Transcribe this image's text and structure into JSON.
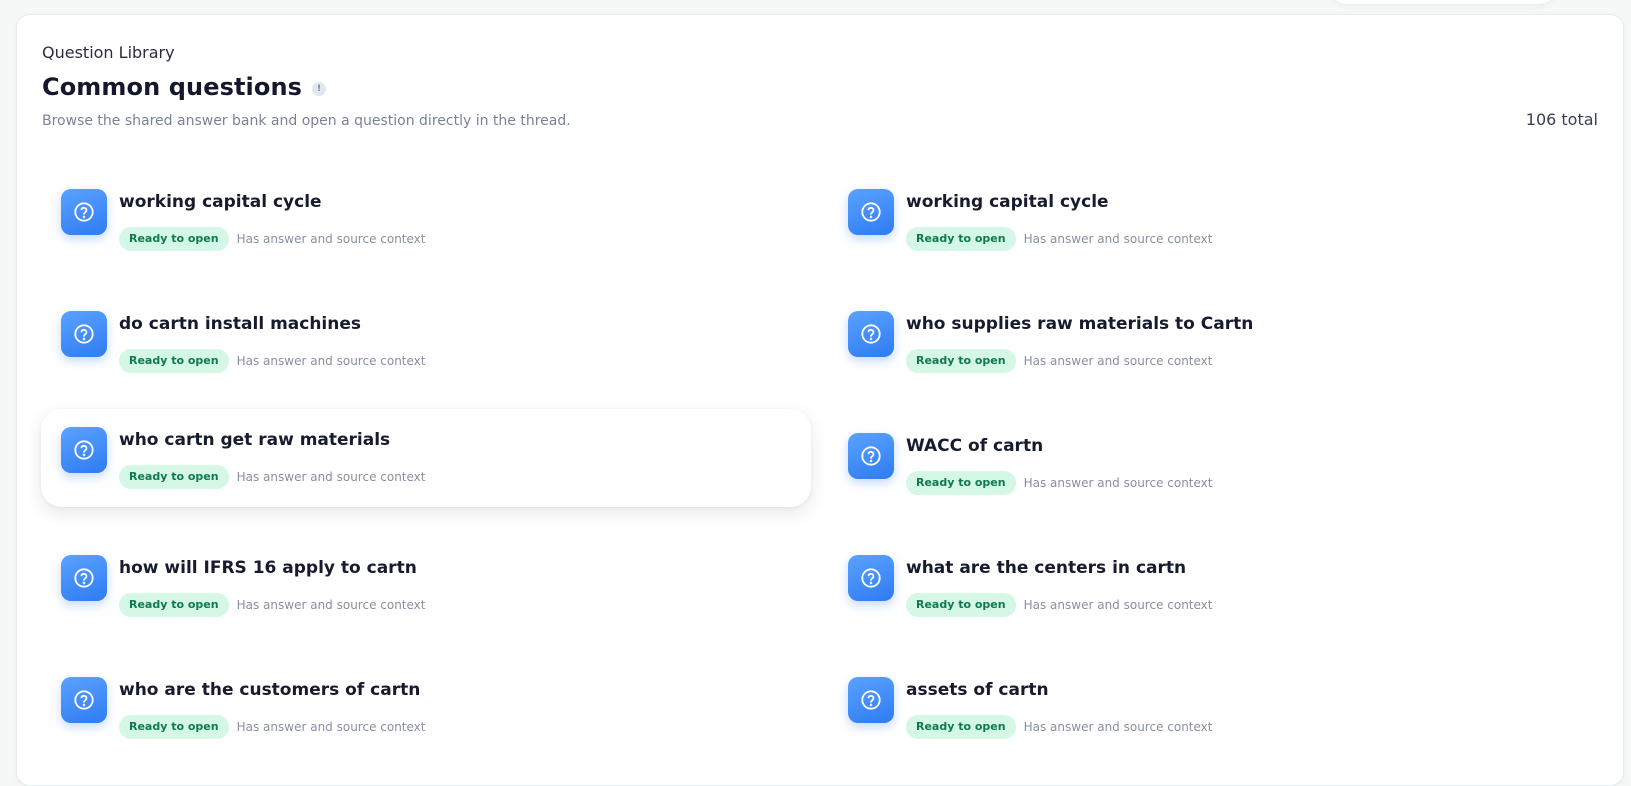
{
  "header": {
    "eyebrow": "Question Library",
    "title": "Common questions",
    "info_icon": "!",
    "subtitle": "Browse the shared answer bank and open a question directly in the thread.",
    "total": "106 total"
  },
  "questions": [
    {
      "title": "working capital cycle",
      "badge": "Ready to open",
      "meta": "Has answer and source context"
    },
    {
      "title": "working capital cycle",
      "badge": "Ready to open",
      "meta": "Has answer and source context"
    },
    {
      "title": "do cartn install machines",
      "badge": "Ready to open",
      "meta": "Has answer and source context"
    },
    {
      "title": "who supplies raw materials to Cartn",
      "badge": "Ready to open",
      "meta": "Has answer and source context"
    },
    {
      "title": "who cartn get raw materials",
      "badge": "Ready to open",
      "meta": "Has answer and source context"
    },
    {
      "title": "WACC of cartn",
      "badge": "Ready to open",
      "meta": "Has answer and source context"
    },
    {
      "title": "how will IFRS 16 apply to cartn",
      "badge": "Ready to open",
      "meta": "Has answer and source context"
    },
    {
      "title": "what are the centers in cartn",
      "badge": "Ready to open",
      "meta": "Has answer and source context"
    },
    {
      "title": "who are the customers of cartn",
      "badge": "Ready to open",
      "meta": "Has answer and source context"
    },
    {
      "title": "assets of cartn",
      "badge": "Ready to open",
      "meta": "Has answer and source context"
    }
  ],
  "icons": {
    "question": "question-circle-icon"
  },
  "colors": {
    "accent": "#3b86f7",
    "badge_bg": "#d4f7e6",
    "badge_text": "#0e7a4e"
  }
}
